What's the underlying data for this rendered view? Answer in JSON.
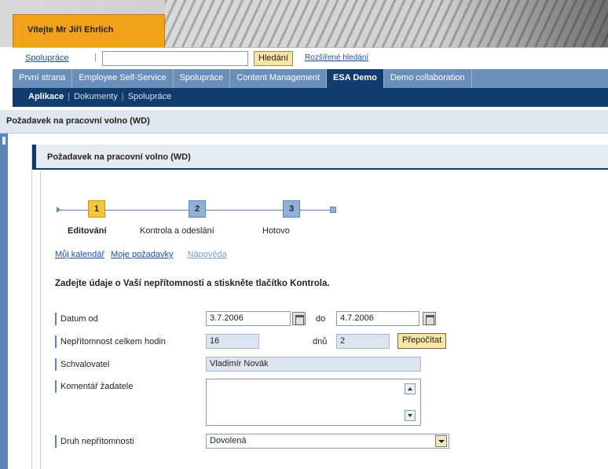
{
  "header": {
    "welcome": "Vítejte Mr Jiří Ehrlich"
  },
  "search": {
    "scope_link": "Spolupráce",
    "separator": "|",
    "query": "",
    "button": "Hledání",
    "advanced_link": "Rozšířené hledání"
  },
  "tabs": [
    {
      "label": "První strana",
      "active": false
    },
    {
      "label": "Employee Self-Service",
      "active": false
    },
    {
      "label": "Spolupráce",
      "active": false
    },
    {
      "label": "Content Management",
      "active": false
    },
    {
      "label": "ESA Demo",
      "active": true
    },
    {
      "label": "Demo collaboration",
      "active": false
    }
  ],
  "subnav": {
    "items": [
      "Aplikace",
      "Dokumenty",
      "Spolupráce"
    ],
    "separator": "|"
  },
  "page": {
    "title": "Požadavek na pracovní volno (WD)"
  },
  "panel": {
    "title": "Požadavek na pracovní volno (WD)"
  },
  "steps": [
    {
      "number": "1",
      "label": "Editování",
      "current": true
    },
    {
      "number": "2",
      "label": "Kontrola a odeslání",
      "current": false
    },
    {
      "number": "3",
      "label": "Hotovo",
      "current": false
    }
  ],
  "links": {
    "calendar": "Můj kalendář",
    "my_requests": "Moje požadavky",
    "help": "Nápověda"
  },
  "instructions": "Zadejte údaje o Vaší nepřítomnosti a stiskněte tlačítko Kontrola.",
  "form": {
    "date_from_label": "Datum od",
    "date_from": "3.7.2006",
    "to_label": "do",
    "date_to": "4.7.2006",
    "hours_label": "Nepřítomnost celkem hodin",
    "hours": "16",
    "days_label": "dnů",
    "days": "2",
    "recalc_button": "Přepočítat",
    "approver_label": "Schvalovatel",
    "approver": "Vladimír Novák",
    "comment_label": "Komentář žadatele",
    "comment": "",
    "absence_type_label": "Druh nepřítomnosti",
    "absence_type": "Dovolená"
  },
  "colors": {
    "nav_dark": "#0f3b6d",
    "nav_light": "#6a8fba",
    "accent_orange": "#f2a21a",
    "step_current": "#f6c540"
  }
}
